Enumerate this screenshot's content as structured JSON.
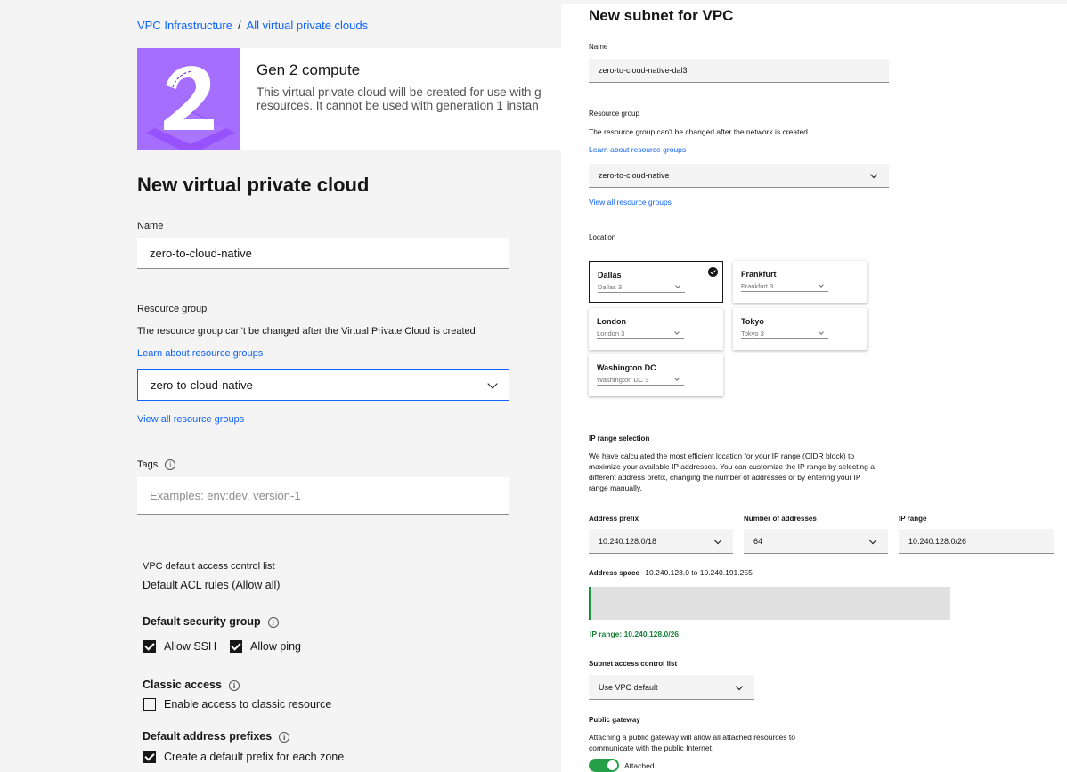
{
  "breadcrumb": {
    "item1": "VPC Infrastructure",
    "separator": "/",
    "item2": "All virtual private clouds"
  },
  "gen2": {
    "title": "Gen 2 compute",
    "desc_line1": "This virtual private cloud will be created for use with g",
    "desc_line2": "resources. It cannot be used with generation 1 instan"
  },
  "vpc": {
    "title": "New virtual private cloud",
    "name_label": "Name",
    "name_value": "zero-to-cloud-native",
    "rg_label": "Resource group",
    "rg_helper": "The resource group can't be changed after the Virtual Private Cloud is created",
    "rg_learn": "Learn about resource groups",
    "rg_value": "zero-to-cloud-native",
    "rg_view_all": "View all resource groups",
    "tags_label": "Tags",
    "tags_placeholder": "Examples: env:dev, version-1",
    "acl_label": "VPC default access control list",
    "acl_value": "Default ACL rules (Allow all)",
    "sg_label": "Default security group",
    "allow_ssh": "Allow SSH",
    "allow_ping": "Allow ping",
    "classic_label": "Classic access",
    "classic_cb": "Enable access to classic resource",
    "prefix_label": "Default address prefixes",
    "prefix_cb": "Create a default prefix for each zone",
    "allow_ssh_checked": true,
    "allow_ping_checked": true,
    "classic_checked": false,
    "prefix_checked": true
  },
  "subnet": {
    "title": "New subnet for VPC",
    "name_label": "Name",
    "name_value": "zero-to-cloud-native-dal3",
    "rg_label": "Resource group",
    "rg_helper": "The resource group can't be changed after the network is created",
    "rg_learn": "Learn about resource groups",
    "rg_value": "zero-to-cloud-native",
    "rg_view_all": "View all resource groups",
    "location_label": "Location",
    "locations": [
      {
        "name": "Dallas",
        "zone": "Dallas 3",
        "selected": true
      },
      {
        "name": "Frankfurt",
        "zone": "Frankfurt 3",
        "selected": false
      },
      {
        "name": "London",
        "zone": "London 3",
        "selected": false
      },
      {
        "name": "Tokyo",
        "zone": "Tokyo 3",
        "selected": false
      },
      {
        "name": "Washington DC",
        "zone": "Washington DC 3",
        "selected": false
      }
    ],
    "ip_label": "IP range selection",
    "ip_helper_1": "We have calculated the most efficient location for your IP range (CIDR block) to",
    "ip_helper_2": "maximize your available IP addresses. You can customize the IP range by selecting a",
    "ip_helper_3": "different address prefix, changing the number of addresses or by entering your IP",
    "ip_helper_4": "range manually.",
    "prefix_label": "Address prefix",
    "prefix_value": "10.240.128.0/18",
    "num_label": "Number of addresses",
    "num_value": "64",
    "range_label": "IP range",
    "range_value": "10.240.128.0/26",
    "space_label": "Address space",
    "space_value": "10.240.128.0 to 10.240.191.255",
    "space_used_fraction": 0.0039,
    "ip_range_text": "IP range: 10.240.128.0/26",
    "acl_label": "Subnet access control list",
    "acl_value": "Use VPC default",
    "gw_label": "Public gateway",
    "gw_helper_1": "Attaching a public gateway will allow all attached resources to",
    "gw_helper_2": "communicate with the public Internet.",
    "gw_state": "Attached",
    "gw_on": true
  },
  "colors": {
    "link": "#0f62fe",
    "accent_purple": "#a56eff",
    "success": "#24a148",
    "success_text": "#198038"
  }
}
